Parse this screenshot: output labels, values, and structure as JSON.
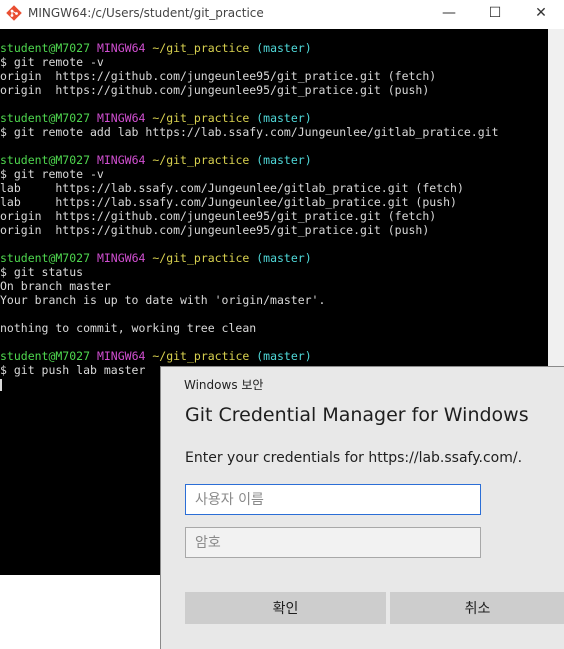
{
  "window": {
    "title": "MINGW64:/c/Users/student/git_practice",
    "minimize_glyph": "—",
    "maximize_glyph": "☐",
    "close_glyph": "✕"
  },
  "terminal": {
    "prompt": {
      "user": "student@M7027",
      "host": "MINGW64",
      "path": "~/git_practice",
      "branch": "(master)"
    },
    "blocks": [
      {
        "command": "$ git remote -v",
        "output": [
          "origin  https://github.com/jungeunlee95/git_pratice.git (fetch)",
          "origin  https://github.com/jungeunlee95/git_pratice.git (push)"
        ]
      },
      {
        "command": "$ git remote add lab https://lab.ssafy.com/Jungeunlee/gitlab_pratice.git",
        "output": []
      },
      {
        "command": "$ git remote -v",
        "output": [
          "lab     https://lab.ssafy.com/Jungeunlee/gitlab_pratice.git (fetch)",
          "lab     https://lab.ssafy.com/Jungeunlee/gitlab_pratice.git (push)",
          "origin  https://github.com/jungeunlee95/git_pratice.git (fetch)",
          "origin  https://github.com/jungeunlee95/git_pratice.git (push)"
        ]
      },
      {
        "command": "$ git status",
        "output": [
          "On branch master",
          "Your branch is up to date with 'origin/master'.",
          "",
          "nothing to commit, working tree clean"
        ]
      },
      {
        "command": "$ git push lab master",
        "output": []
      }
    ]
  },
  "dialog": {
    "caption": "Windows 보안",
    "heading": "Git Credential Manager for Windows",
    "message": "Enter your credentials for https://lab.ssafy.com/.",
    "username_placeholder": "사용자 이름",
    "username_value": "",
    "password_placeholder": "암호",
    "ok_label": "확인",
    "cancel_label": "취소"
  },
  "colors": {
    "terminal_bg": "#000000",
    "terminal_text": "#d9d9d9",
    "prompt_user": "#4fd84f",
    "prompt_host": "#d14fd1",
    "prompt_path": "#d8d14f",
    "prompt_branch": "#4fd8d8",
    "dialog_bg": "#e8e8e8",
    "focus_border": "#2b6ed6"
  },
  "icons": {
    "app": "git-bash-icon"
  }
}
